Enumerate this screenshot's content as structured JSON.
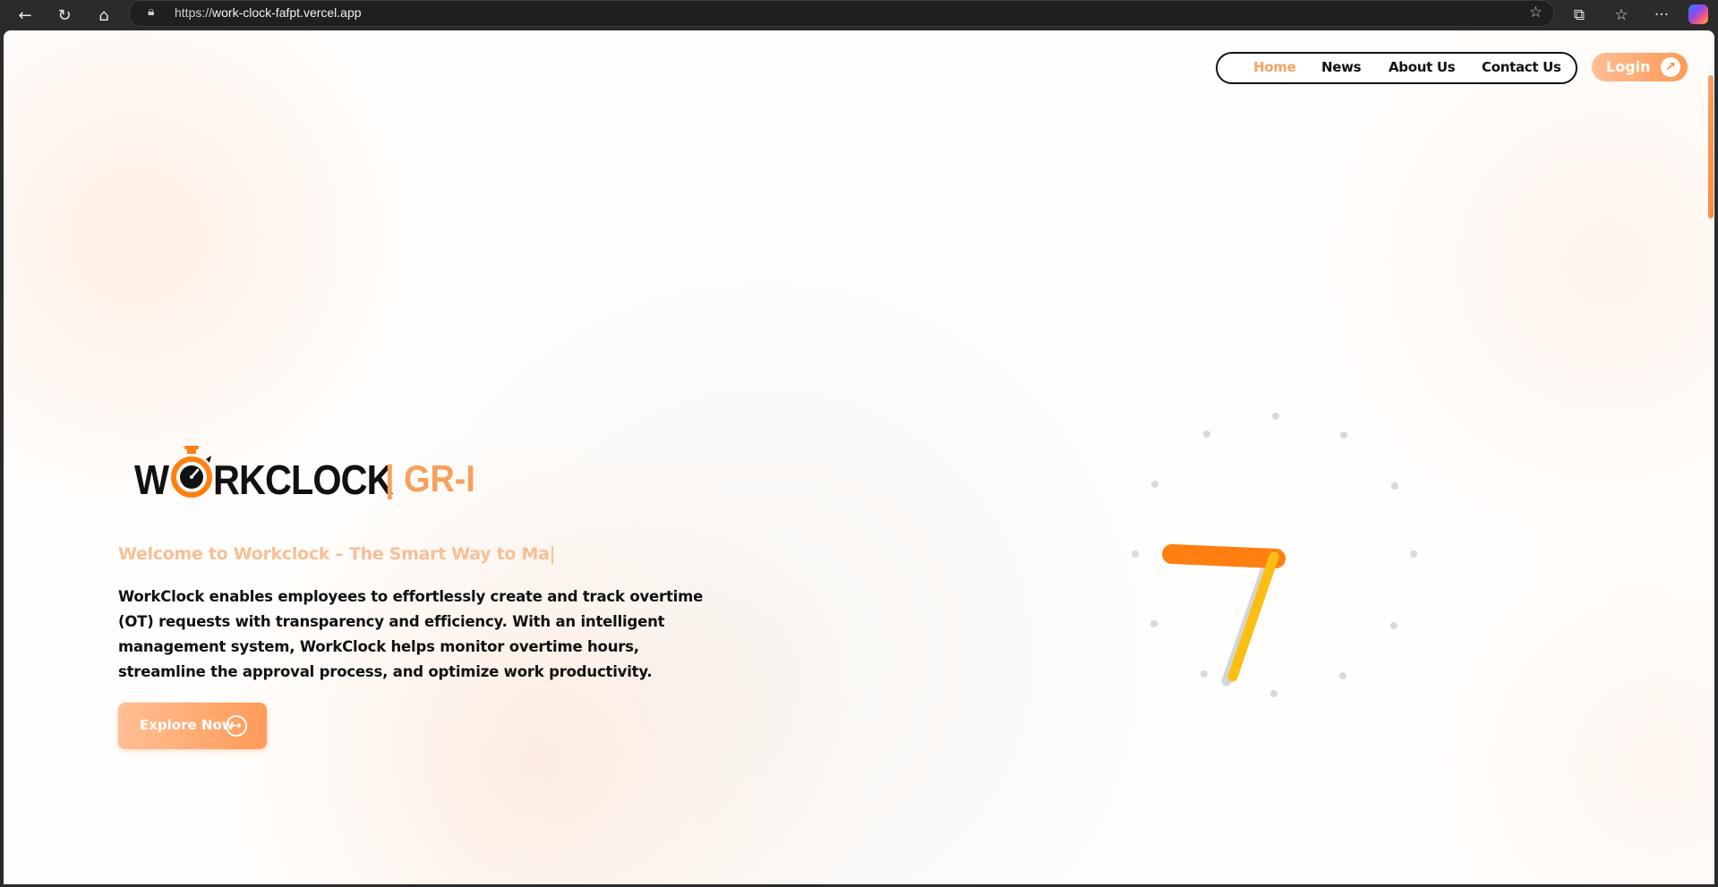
{
  "browser": {
    "url_scheme": "https://",
    "url_host": "work-clock-fafpt.vercel.app",
    "icons": [
      "back-arrow-icon",
      "refresh-icon",
      "home-icon",
      "lock-icon",
      "star-icon",
      "extensions-icon",
      "favorites-icon",
      "more-icon",
      "copilot-icon"
    ]
  },
  "nav": {
    "items": [
      {
        "label": "Home",
        "active": true
      },
      {
        "label": "News",
        "active": false
      },
      {
        "label": "About Us",
        "active": false
      },
      {
        "label": "Contact Us",
        "active": false
      }
    ],
    "login_label": "Login"
  },
  "logo": {
    "w": "W",
    "rest": "RKCLOCK",
    "suffix": "| GR-I"
  },
  "hero": {
    "subheading": "Welcome to Workclock – The Smart Way to Ma",
    "description": "WorkClock enables employees to effortlessly create and track overtime (OT) requests with transparency and efficiency. With an intelligent management system, WorkClock helps monitor overtime hours, streamline the approval process, and optimize work productivity.",
    "cta_label": "Explore Now"
  },
  "colors": {
    "accent": "#f7a15e",
    "accent_dark": "#ff7f11",
    "hand_yellow": "#fbbf13",
    "text": "#111111"
  }
}
